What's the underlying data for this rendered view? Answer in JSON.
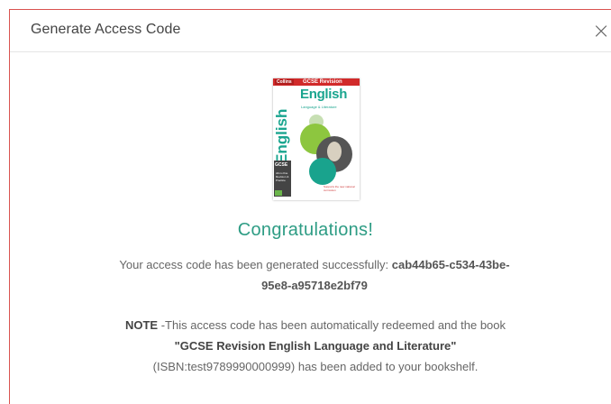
{
  "modal": {
    "title": "Generate Access Code",
    "close_label": "×"
  },
  "book": {
    "cover_brand": "Collins",
    "cover_series": "GCSE Revision",
    "cover_subject": "English",
    "cover_subline": "Language & Literature",
    "cover_vertical": "English",
    "cover_badge": "GCSE",
    "cover_badge_sub": "All-in-One Revision & Practice",
    "cover_note": "Supports the new national curriculum"
  },
  "result": {
    "heading": "Congratulations!",
    "message_prefix": "Your access code has been generated successfully: ",
    "access_code": "cab44b65-c534-43be-95e8-a95718e2bf79"
  },
  "note": {
    "label": "NOTE",
    "text_part1": " -This access code has been automatically redeemed and the book",
    "book_title": "\"GCSE Revision English Language and Literature\"",
    "text_part2": "(ISBN:test9789990000999) has been added to your bookshelf."
  },
  "colors": {
    "accent": "#2d9c84",
    "border": "#d9534f",
    "cover_red": "#d12a2a"
  }
}
